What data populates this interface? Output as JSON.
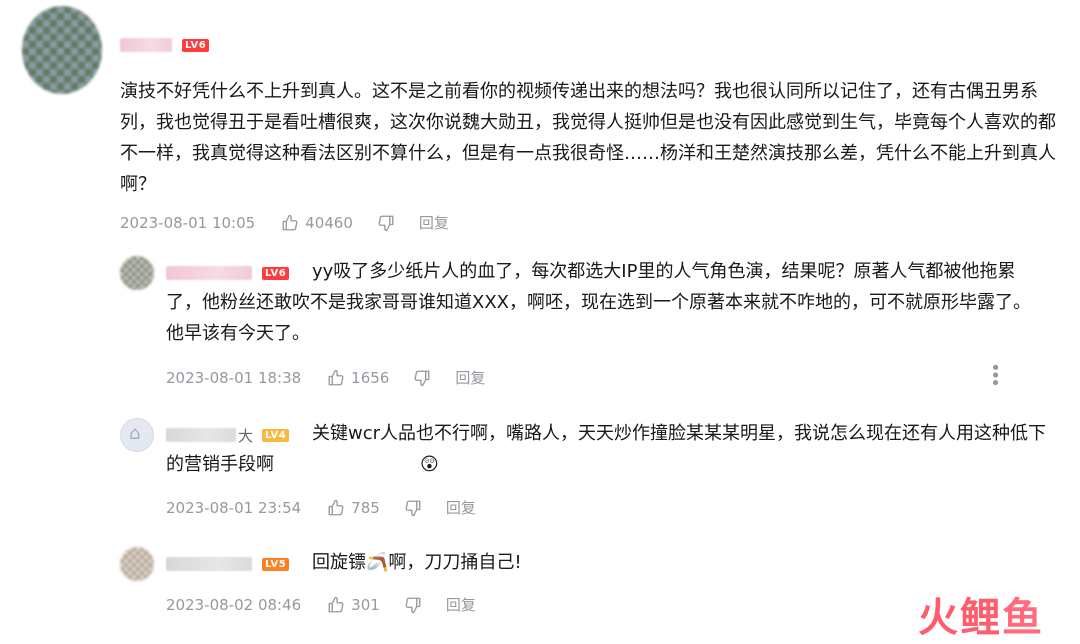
{
  "comments": {
    "main": {
      "level": "LV6",
      "text": "演技不好凭什么不上升到真人。这不是之前看你的视频传递出来的想法吗？我也很认同所以记住了，还有古偶丑男系列，我也觉得丑于是看吐槽很爽，这次你说魏大勋丑，我觉得人挺帅但是也没有因此感觉到生气，毕竟每个人喜欢的都不一样，我真觉得这种看法区别不算什么，但是有一点我很奇怪……杨洋和王楚然演技那么差，凭什么不能上升到真人啊？",
      "date": "2023-08-01 10:05",
      "likes": "40460",
      "reply_label": "回复"
    },
    "replies": [
      {
        "level": "LV6",
        "text": "yy吸了多少纸片人的血了，每次都选大IP里的人气角色演，结果呢？原著人气都被他拖累了，他粉丝还敢吹不是我家哥哥谁知道XXX，啊呸，现在选到一个原著本来就不咋地的，可不就原形毕露了。他早该有今天了。",
        "date": "2023-08-01 18:38",
        "likes": "1656",
        "reply_label": "回复"
      },
      {
        "name_suffix": "大",
        "level": "LV4",
        "text": "关键wcr人品也不行啊，嘴路人，天天炒作撞脸某某某明星，我说怎么现在还有人用这种低下的营销手段啊",
        "emoji": "😲",
        "date": "2023-08-01 23:54",
        "likes": "785",
        "reply_label": "回复"
      },
      {
        "level": "LV5",
        "text_before": "回旋镖",
        "emoji": "🪃",
        "text_after": "啊，刀刀捅自己!",
        "date": "2023-08-02 08:46",
        "likes": "301",
        "reply_label": "回复"
      }
    ]
  },
  "watermark": {
    "text1": "火鲤",
    "text2": "鱼"
  },
  "icons": {
    "like": "thumbs-up-icon",
    "dislike": "thumbs-down-icon",
    "more": "more-vertical-icon"
  }
}
